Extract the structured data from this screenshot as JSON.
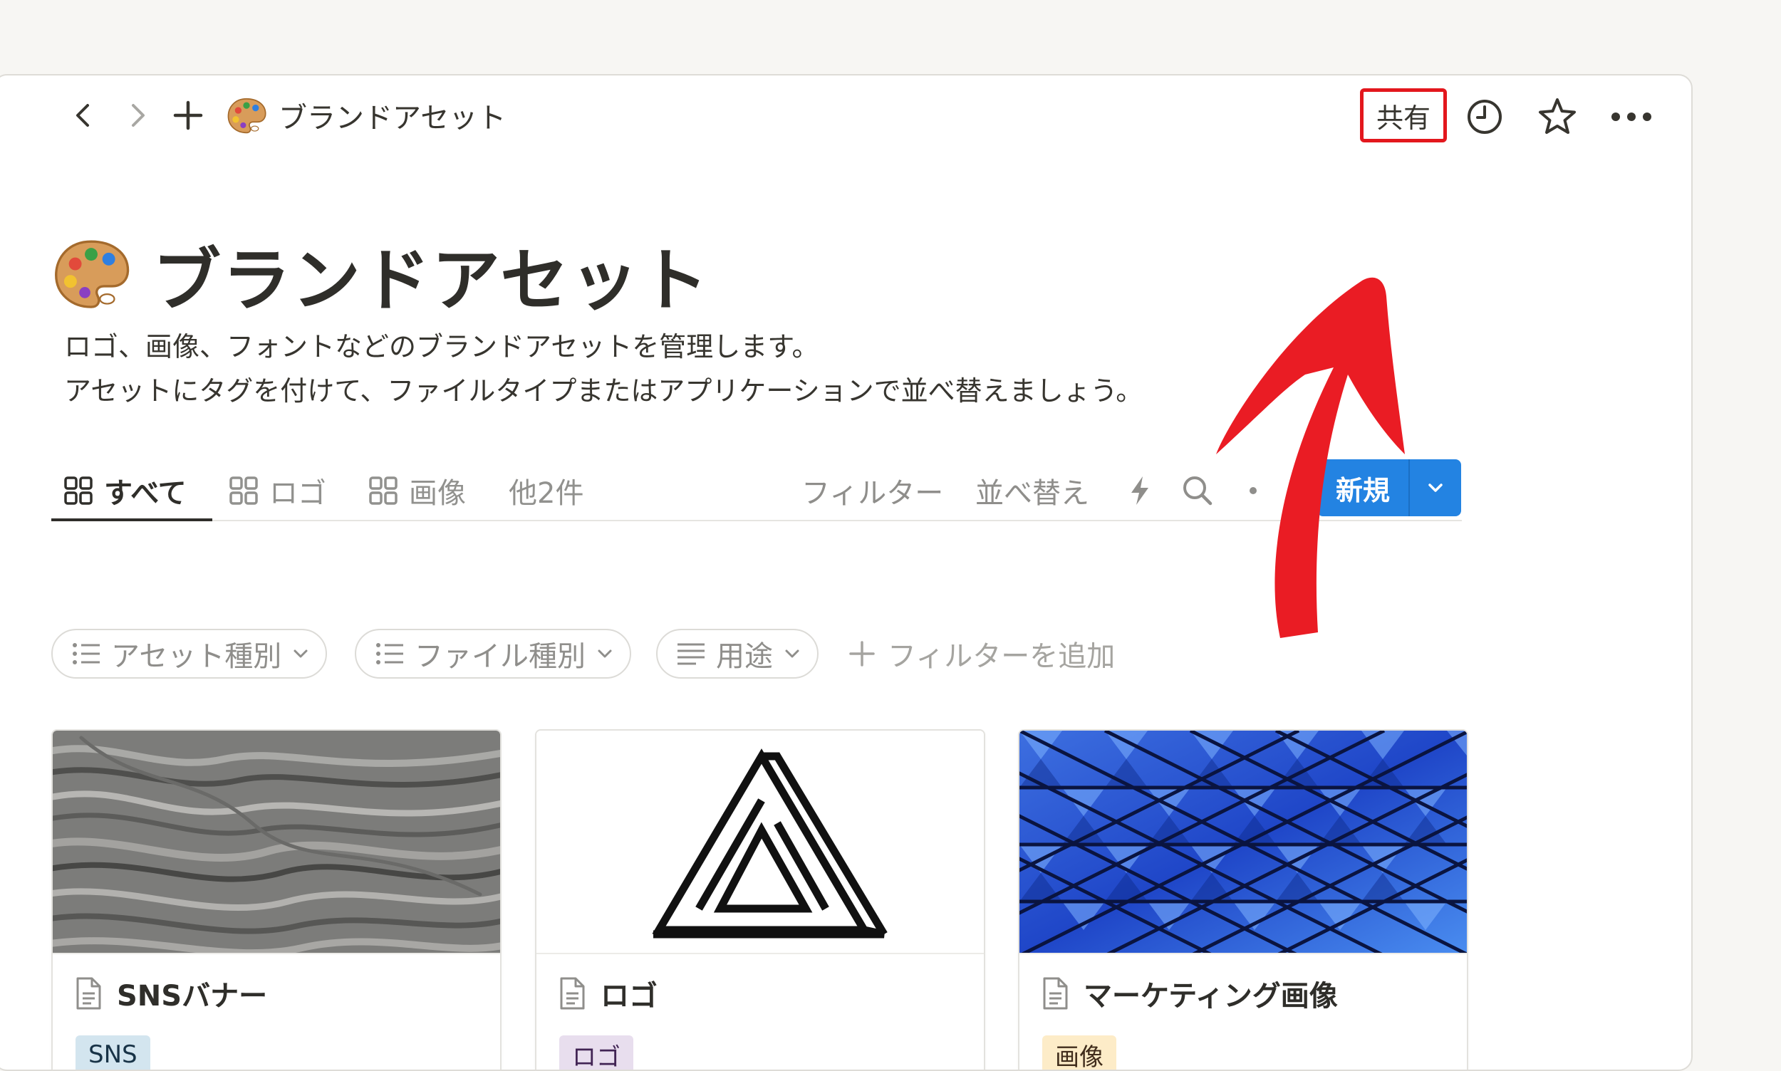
{
  "breadcrumb": {
    "title": "ブランドアセット"
  },
  "topbar": {
    "share_label": "共有"
  },
  "page": {
    "title": "ブランドアセット",
    "description_line1": "ロゴ、画像、フォントなどのブランドアセットを管理します。",
    "description_line2": "アセットにタグを付けて、ファイルタイプまたはアプリケーションで並べ替えましょう。"
  },
  "tabs": [
    {
      "label": "すべて",
      "icon": "gallery-icon"
    },
    {
      "label": "ロゴ",
      "icon": "gallery-icon"
    },
    {
      "label": "画像",
      "icon": "gallery-icon"
    },
    {
      "label": "他2件"
    }
  ],
  "toolbar": {
    "filter_label": "フィルター",
    "sort_label": "並べ替え",
    "new_label": "新規",
    "icons": [
      "lightning-icon",
      "search-icon",
      "more-icon",
      "chevron-down-icon"
    ]
  },
  "filters": {
    "chips": [
      {
        "label": "アセット種別",
        "icon": "list-icon"
      },
      {
        "label": "ファイル種別",
        "icon": "list-icon"
      },
      {
        "label": "用途",
        "icon": "text-icon"
      }
    ],
    "add_label": "フィルターを追加"
  },
  "cards": [
    {
      "title": "SNSバナー",
      "tag": "SNS",
      "tag_bg": "#d3e5ef",
      "tag_color": "#183347",
      "cover": "marble"
    },
    {
      "title": "ロゴ",
      "tag": "ロゴ",
      "tag_bg": "#e8deee",
      "tag_color": "#412454",
      "cover": "penrose-triangle-logo"
    },
    {
      "title": "マーケティング画像",
      "tag": "画像",
      "tag_bg": "#fdecc8",
      "tag_color": "#402c1b",
      "cover": "blue-glass-roof"
    }
  ],
  "colors": {
    "accent": "#2383e2",
    "annotation": "#e3171d"
  }
}
